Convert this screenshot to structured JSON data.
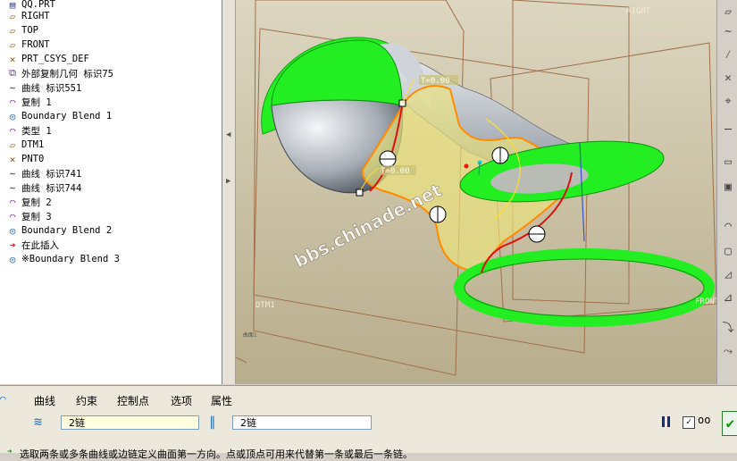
{
  "model_tree": {
    "items": [
      {
        "label": "QQ.PRT",
        "icon": "part-icon"
      },
      {
        "label": "RIGHT",
        "icon": "datum-plane-icon"
      },
      {
        "label": "TOP",
        "icon": "datum-plane-icon"
      },
      {
        "label": "FRONT",
        "icon": "datum-plane-icon"
      },
      {
        "label": "PRT_CSYS_DEF",
        "icon": "csys-icon"
      },
      {
        "label": "外部复制几何 标识75",
        "icon": "copy-geometry-icon"
      },
      {
        "label": "曲线 标识551",
        "icon": "curve-icon"
      },
      {
        "label": "复制 1",
        "icon": "surface-copy-icon"
      },
      {
        "label": "Boundary Blend 1",
        "icon": "boundary-blend-icon"
      },
      {
        "label": "类型 1",
        "icon": "surface-copy-icon"
      },
      {
        "label": "DTM1",
        "icon": "datum-plane-icon"
      },
      {
        "label": "PNT0",
        "icon": "datum-point-icon"
      },
      {
        "label": "曲线 标识741",
        "icon": "curve-icon"
      },
      {
        "label": "曲线 标识744",
        "icon": "curve-icon"
      },
      {
        "label": "复制 2",
        "icon": "surface-copy-icon"
      },
      {
        "label": "复制 3",
        "icon": "surface-copy-icon"
      },
      {
        "label": "Boundary Blend 2",
        "icon": "boundary-blend-icon"
      },
      {
        "label": "在此插入",
        "icon": "insert-here-arrow-icon"
      },
      {
        "label": "※Boundary Blend 3",
        "icon": "boundary-blend-icon"
      }
    ]
  },
  "viewport": {
    "labels": {
      "right": "RIGHT",
      "dtm1": "DTM1",
      "front": "FRONT",
      "t1": "T=0.00",
      "t2": "T=0.00",
      "watermark": "bbs.chinade.net",
      "small": "曲面1"
    }
  },
  "dashboard": {
    "tabs": [
      "曲线",
      "约束",
      "控制点",
      "选项",
      "属性"
    ],
    "first_direction": "2链",
    "second_direction": "2链",
    "status_message": "选取两条或多条曲线或边链定义曲面第一方向。点或顶点可用来代替第一条或最后一条链。"
  },
  "colors": {
    "viewport_bg": "#c9c0a3",
    "surface_green": "#22ee22",
    "surface_gray": "#a9b0b8",
    "boundary_orange": "#ff8c00",
    "chain_red": "#dd1111",
    "datum_brown": "#a0704a"
  }
}
